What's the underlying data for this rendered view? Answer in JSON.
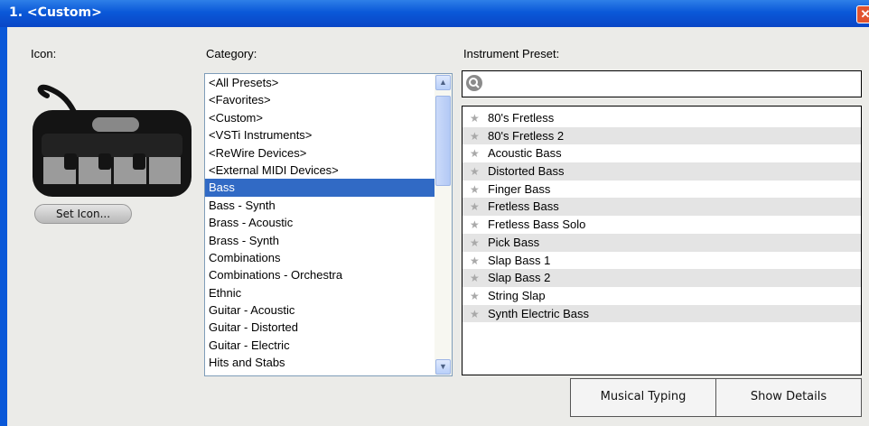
{
  "window": {
    "title": "1. <Custom>",
    "close_symbol": "✕"
  },
  "icon_label": "Icon:",
  "category_label": "Category:",
  "preset_label": "Instrument Preset:",
  "set_icon_button": "Set Icon...",
  "categories": [
    "<All Presets>",
    "<Favorites>",
    "<Custom>",
    "<VSTi Instruments>",
    "<ReWire Devices>",
    "<External MIDI Devices>",
    "Bass",
    "Bass - Synth",
    "Brass - Acoustic",
    "Brass - Synth",
    "Combinations",
    "Combinations - Orchestra",
    "Ethnic",
    "Guitar - Acoustic",
    "Guitar - Distorted",
    "Guitar - Electric",
    "Hits and Stabs"
  ],
  "selected_category": "Bass",
  "search": {
    "placeholder": ""
  },
  "presets": [
    "80's Fretless",
    "80's Fretless 2",
    "Acoustic Bass",
    "Distorted Bass",
    "Finger Bass",
    "Fretless Bass",
    "Fretless Bass Solo",
    "Pick Bass",
    "Slap Bass 1",
    "Slap Bass 2",
    "String Slap",
    "Synth Electric Bass"
  ],
  "buttons": {
    "musical_typing": "Musical Typing",
    "show_details": "Show Details"
  },
  "icons": {
    "star": "star-icon",
    "search": "search-icon",
    "keyboard": "keyboard-icon"
  },
  "colors": {
    "titlebar": "#0a58d8",
    "selection": "#316ac5"
  }
}
